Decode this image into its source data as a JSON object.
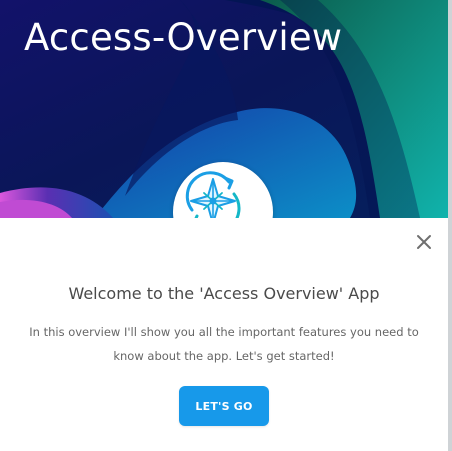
{
  "hero": {
    "title": "Access-Overview",
    "logo_icon": "compass-sync-icon"
  },
  "dialog": {
    "close_icon": "close-icon",
    "welcome_title": "Welcome to the 'Access Overview' App",
    "intro_text": "In this overview I'll show you all the important features you need to know about the app. Let's get started!",
    "primary_button_label": "LET'S GO"
  },
  "colors": {
    "hero_navy": "#0a1658",
    "hero_teal": "#0ea5a2",
    "hero_purple": "#c04bd3",
    "button_blue": "#1799ea",
    "heading_gray": "#4a4a4a",
    "body_gray": "#666666"
  }
}
